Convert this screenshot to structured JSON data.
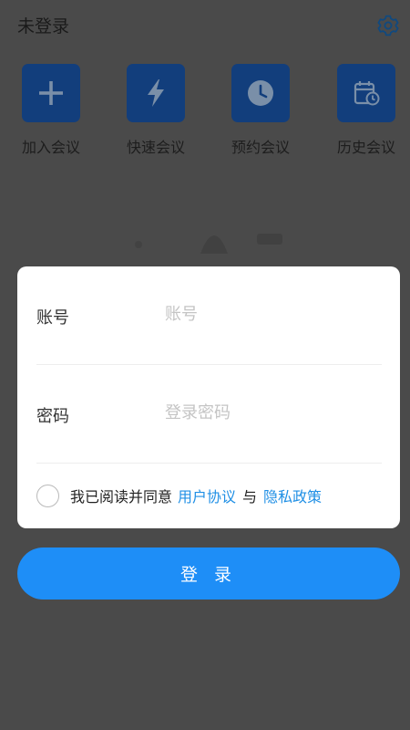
{
  "header": {
    "title": "未登录",
    "settings_icon": "gear-icon"
  },
  "quick_actions": [
    {
      "label": "加入会议",
      "icon": "plus-icon"
    },
    {
      "label": "快速会议",
      "icon": "lightning-icon"
    },
    {
      "label": "预约会议",
      "icon": "clock-icon"
    },
    {
      "label": "历史会议",
      "icon": "calendar-history-icon"
    }
  ],
  "login_form": {
    "account_label": "账号",
    "account_placeholder": "账号",
    "account_value": "",
    "password_label": "密码",
    "password_placeholder": "登录密码",
    "password_value": "",
    "agree_checked": false,
    "agree_prefix": "我已阅读并同意",
    "user_agreement": "用户协议",
    "conjunction": "与",
    "privacy_policy": "隐私政策"
  },
  "login_button": "登 录",
  "colors": {
    "accent": "#1e8ef7",
    "link": "#1f8fe5",
    "tile": "#123e7c",
    "overlay_background": "#4a4a4a"
  }
}
